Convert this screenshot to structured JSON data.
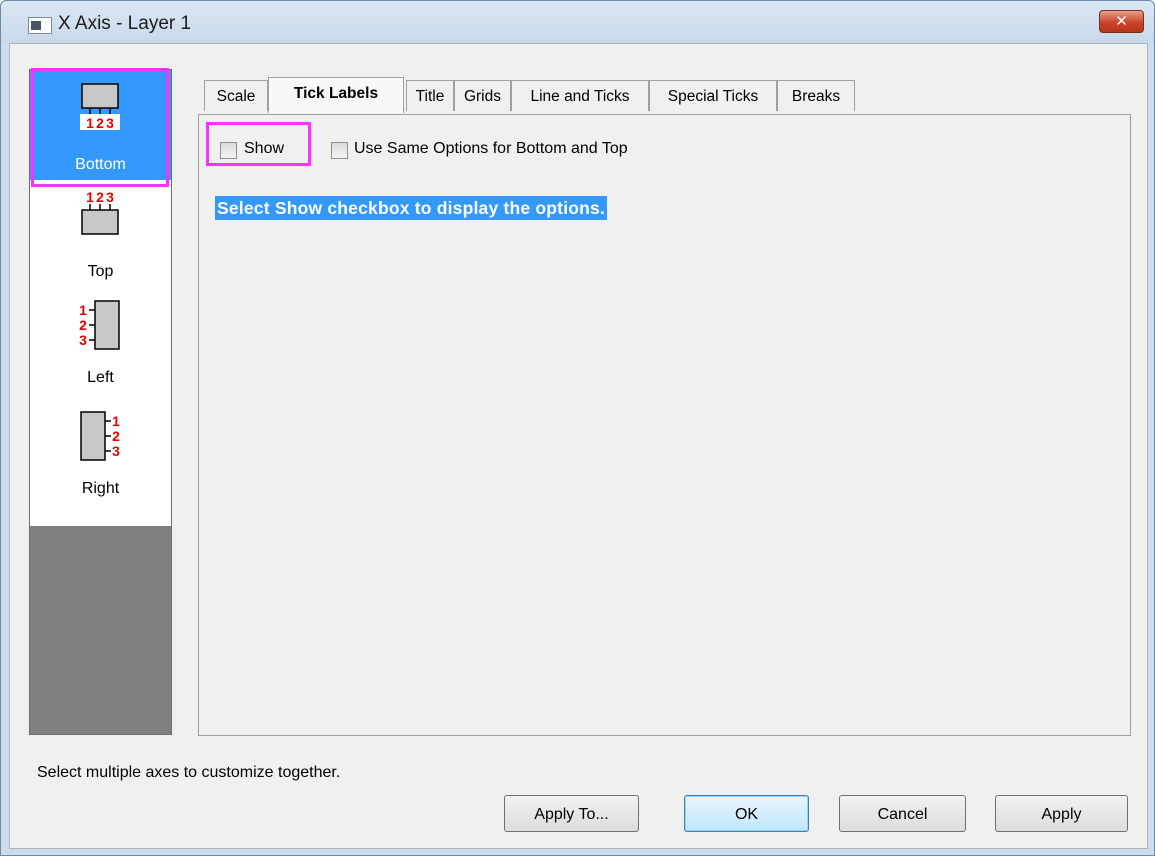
{
  "window": {
    "title": "X Axis - Layer 1",
    "close_symbol": "✕"
  },
  "axes": [
    {
      "label": "Bottom",
      "icon": "axis-bottom-icon",
      "selected": true,
      "tick_digits": [
        "1",
        "2",
        "3"
      ]
    },
    {
      "label": "Top",
      "icon": "axis-top-icon",
      "selected": false,
      "tick_digits": [
        "1",
        "2",
        "3"
      ]
    },
    {
      "label": "Left",
      "icon": "axis-left-icon",
      "selected": false,
      "tick_digits": [
        "1",
        "2",
        "3"
      ]
    },
    {
      "label": "Right",
      "icon": "axis-right-icon",
      "selected": false,
      "tick_digits": [
        "1",
        "2",
        "3"
      ]
    }
  ],
  "tabs": [
    {
      "label": "Scale",
      "active": false
    },
    {
      "label": "Tick Labels",
      "active": true
    },
    {
      "label": "Title",
      "active": false
    },
    {
      "label": "Grids",
      "active": false
    },
    {
      "label": "Line and Ticks",
      "active": false
    },
    {
      "label": "Special Ticks",
      "active": false
    },
    {
      "label": "Breaks",
      "active": false
    }
  ],
  "panel": {
    "show_label": "Show",
    "show_checked": false,
    "same_options_label": "Use Same Options for Bottom and Top",
    "same_options_checked": false,
    "hint": "Select Show checkbox to display the options."
  },
  "status_text": "Select multiple axes to customize together.",
  "buttons": {
    "apply_to": "Apply To...",
    "ok": "OK",
    "cancel": "Cancel",
    "apply": "Apply"
  },
  "colors": {
    "selection": "#3399ff",
    "highlight": "#ff33ff",
    "tick_digit": "#e00000"
  }
}
